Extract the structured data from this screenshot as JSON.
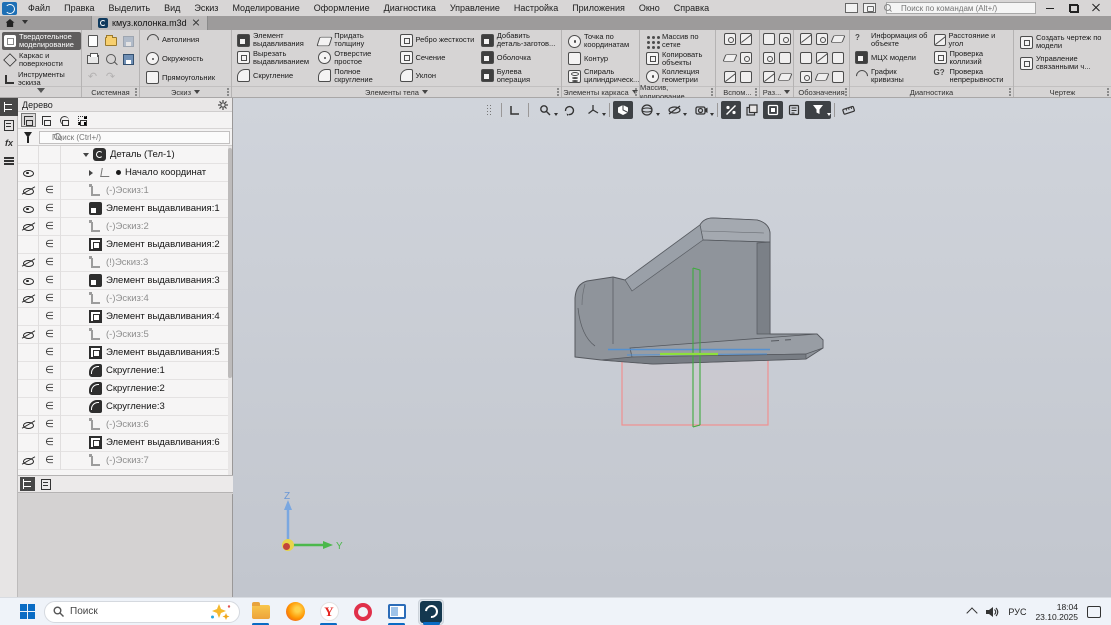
{
  "window": {
    "command_search_placeholder": "Поиск по командам (Alt+/)"
  },
  "menu": {
    "items": [
      "Файл",
      "Правка",
      "Выделить",
      "Вид",
      "Эскиз",
      "Моделирование",
      "Оформление",
      "Диагностика",
      "Управление",
      "Настройка",
      "Приложения",
      "Окно",
      "Справка"
    ]
  },
  "tabbar": {
    "document_tab": "кмуз.колонка.m3d"
  },
  "ribbon": {
    "modes": [
      {
        "label": "Твердотельное моделирование"
      },
      {
        "label": "Каркас и поверхности"
      },
      {
        "label": "Инструменты эскиза"
      }
    ],
    "groups": {
      "system": {
        "label": "Системная"
      },
      "sketch": {
        "label": "Эскиз",
        "items": [
          "Автолиния",
          "Окружность",
          "Прямоугольник"
        ]
      },
      "body": {
        "label": "Элементы тела",
        "items": [
          "Элемент выдавливания",
          "Придать толщину",
          "Ребро жесткости",
          "Добавить деталь-заготов...",
          "Вырезать выдавливанием",
          "Отверстие простое",
          "Сечение",
          "Оболочка",
          "Скругление",
          "Полное скругление",
          "Уклон",
          "Булева операция"
        ]
      },
      "frame": {
        "label": "Элементы каркаса",
        "items": [
          "Точка по координатам",
          "Контур",
          "Спираль цилиндрическ..."
        ]
      },
      "array": {
        "label": "Массив, копирование",
        "items": [
          "Массив по сетке",
          "Копировать объекты",
          "Коллекция геометрии"
        ]
      },
      "aux": {
        "label": "Вспом..."
      },
      "raz": {
        "label": "Раз..."
      },
      "denote": {
        "label": "Обозначения"
      },
      "diag": {
        "label": "Диагностика",
        "items": [
          "Информация об объекте",
          "Расстояние и угол",
          "МЦХ модели",
          "Проверка коллизий",
          "График кривизны",
          "Проверка непрерывности"
        ]
      },
      "draw": {
        "label": "Чертеж",
        "items": [
          "Создать чертеж по модели",
          "Управление связанными ч..."
        ]
      }
    }
  },
  "tree": {
    "title": "Дерево",
    "search_placeholder": "Поиск (Ctrl+/)",
    "glyphs": {
      "section": "∈"
    },
    "root": "Деталь (Тел-1)",
    "origin": "Начало координат",
    "items": [
      {
        "label": "(-)Эскиз:1",
        "eye": "hidden"
      },
      {
        "label": "Элемент выдавливания:1",
        "eye": "visible"
      },
      {
        "label": "(-)Эскиз:2",
        "eye": "hidden"
      },
      {
        "label": "Элемент выдавливания:2",
        "eye": "none"
      },
      {
        "label": "(!)Эскиз:3",
        "eye": "hidden"
      },
      {
        "label": "Элемент выдавливания:3",
        "eye": "visible"
      },
      {
        "label": "(-)Эскиз:4",
        "eye": "hidden"
      },
      {
        "label": "Элемент выдавливания:4",
        "eye": "none"
      },
      {
        "label": "(-)Эскиз:5",
        "eye": "hidden"
      },
      {
        "label": "Элемент выдавливания:5",
        "eye": "none"
      },
      {
        "label": "Скругление:1",
        "eye": "none"
      },
      {
        "label": "Скругление:2",
        "eye": "none"
      },
      {
        "label": "Скругление:3",
        "eye": "none"
      },
      {
        "label": "(-)Эскиз:6",
        "eye": "hidden"
      },
      {
        "label": "Элемент выдавливания:6",
        "eye": "none"
      },
      {
        "label": "(-)Эскиз:7",
        "eye": "hidden"
      }
    ],
    "panel_icons": {
      "fx": "fx"
    }
  },
  "viewport": {
    "axis": {
      "z": "Z",
      "y": "Y"
    }
  },
  "taskbar": {
    "search_label": "Поиск",
    "yandex_letter": "Y",
    "tray": {
      "lang": "РУС",
      "time": "18:04",
      "date": "23.10.2025"
    }
  }
}
